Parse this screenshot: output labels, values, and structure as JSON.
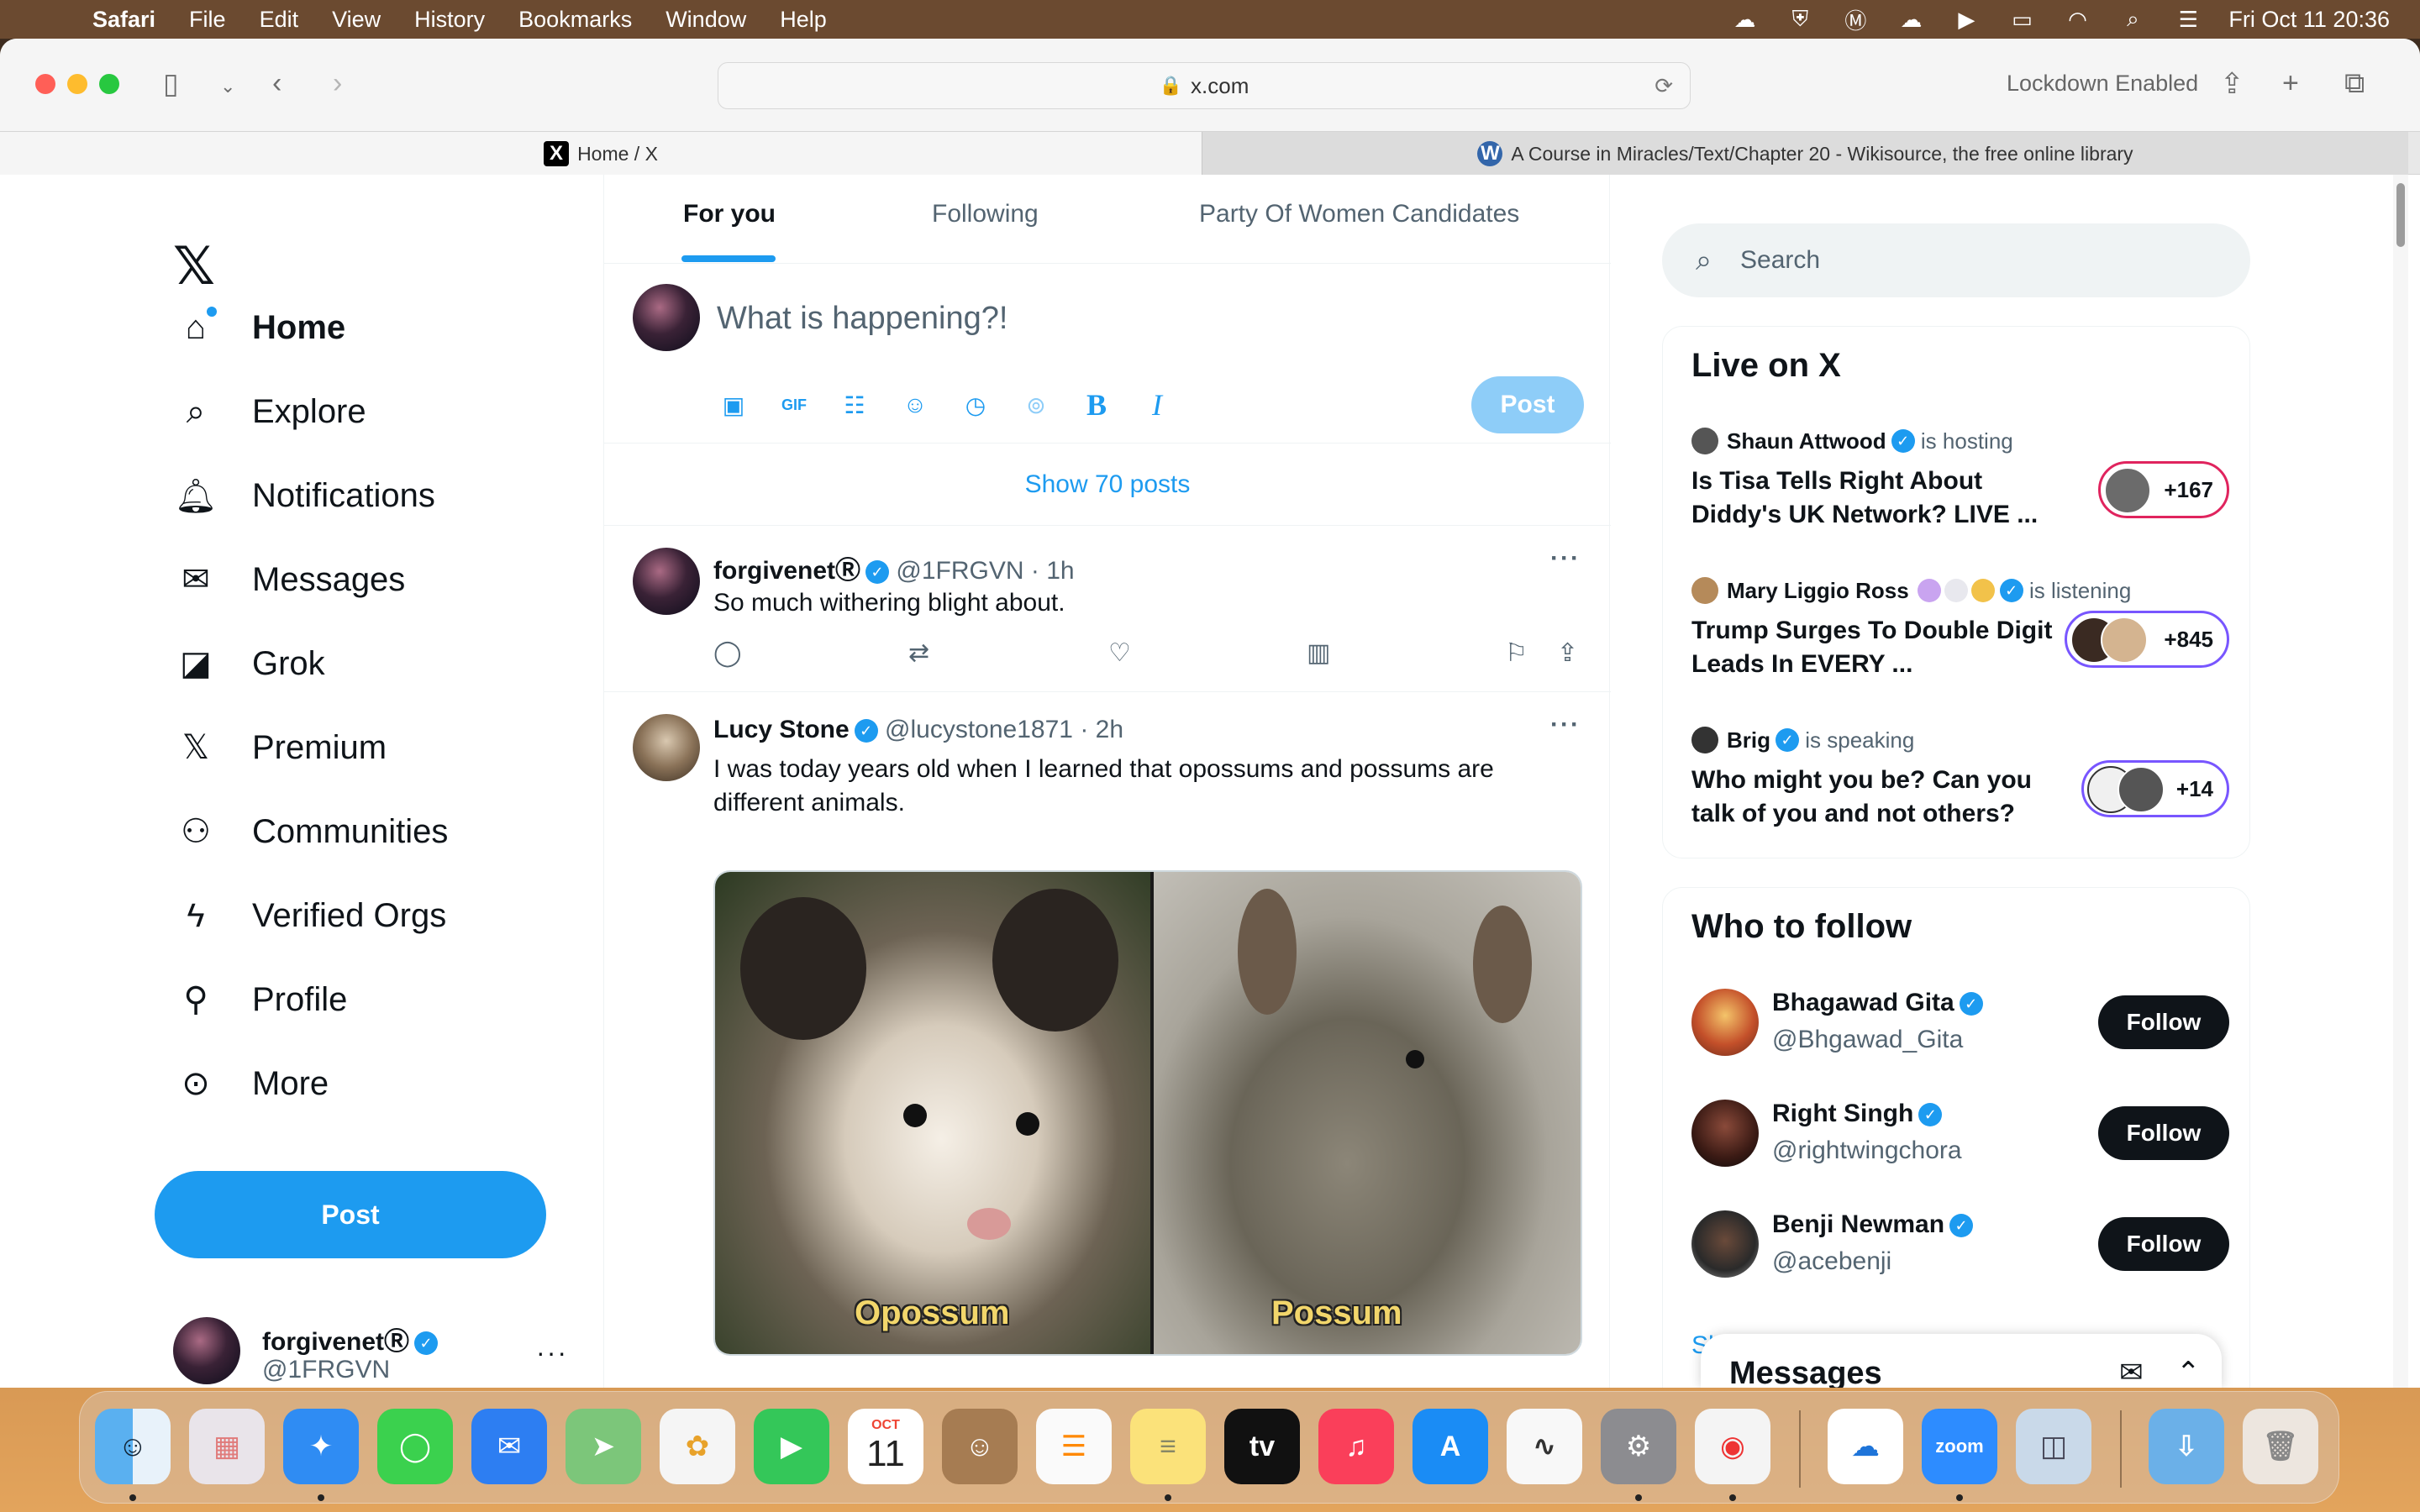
{
  "menubar": {
    "app": "Safari",
    "items": [
      "File",
      "Edit",
      "View",
      "History",
      "Bookmarks",
      "Window",
      "Help"
    ],
    "clock": "Fri Oct 11  20:36",
    "status_icons": [
      "cloud-sync-icon",
      "shield-icon",
      "malwarebytes-icon",
      "creative-cloud-icon",
      "play-icon",
      "battery-icon",
      "wifi-icon",
      "spotlight-icon",
      "control-center-icon"
    ]
  },
  "browser": {
    "url": "x.com",
    "lockdown": "Lockdown Enabled",
    "tabs": [
      {
        "title": "Home / X"
      },
      {
        "title": "A Course in Miracles/Text/Chapter 20 - Wikisource, the free online library"
      }
    ]
  },
  "nav": {
    "items": [
      {
        "label": "Home",
        "icon": "home-icon"
      },
      {
        "label": "Explore",
        "icon": "search-icon"
      },
      {
        "label": "Notifications",
        "icon": "bell-icon"
      },
      {
        "label": "Messages",
        "icon": "mail-icon"
      },
      {
        "label": "Grok",
        "icon": "grok-icon"
      },
      {
        "label": "Premium",
        "icon": "x-logo-icon"
      },
      {
        "label": "Communities",
        "icon": "people-icon"
      },
      {
        "label": "Verified Orgs",
        "icon": "lightning-icon"
      },
      {
        "label": "Profile",
        "icon": "person-icon"
      },
      {
        "label": "More",
        "icon": "more-circle-icon"
      }
    ],
    "post_label": "Post",
    "account": {
      "name": "forgivenetⓇ",
      "handle": "@1FRGVN"
    }
  },
  "feed": {
    "tabs": [
      "For you",
      "Following",
      "Party Of Women Candidates"
    ],
    "composer_placeholder": "What is happening?!",
    "composer_post": "Post",
    "show_posts": "Show 70 posts",
    "tweets": [
      {
        "name": "forgivenetⓇ",
        "handle": "@1FRGVN",
        "time": "1h",
        "text": "So much withering blight about."
      },
      {
        "name": "Lucy Stone",
        "handle": "@lucystone1871",
        "time": "2h",
        "text": "I was today years old when I learned that opossums and possums are different animals.",
        "image_captions": [
          "Opossum",
          "Possum"
        ]
      }
    ]
  },
  "sidebar": {
    "search_placeholder": "Search",
    "live": {
      "title": "Live on X",
      "items": [
        {
          "host": "Shaun Attwood",
          "status": "is hosting",
          "title": "Is Tisa Tells Right About Diddy's UK Network? LIVE ...",
          "count": "+167"
        },
        {
          "host": "Mary Liggio Ross",
          "status": "is listening",
          "title": "Trump Surges To Double Digit Leads In EVERY ...",
          "count": "+845"
        },
        {
          "host": "Brig",
          "status": "is speaking",
          "title": "Who might you be? Can you talk of you and not others?",
          "count": "+14"
        }
      ]
    },
    "who_to_follow": {
      "title": "Who to follow",
      "follow_label": "Follow",
      "items": [
        {
          "name": "Bhagawad Gita",
          "handle": "@Bhgawad_Gita"
        },
        {
          "name": "Right Singh",
          "handle": "@rightwingchora"
        },
        {
          "name": "Benji Newman",
          "handle": "@acebenji"
        }
      ],
      "show_more_partial": "Sh"
    },
    "messages_drawer": "Messages"
  },
  "dock": {
    "apps": [
      "Finder",
      "Launchpad",
      "Safari",
      "Messages",
      "Mail",
      "Maps",
      "Photos",
      "FaceTime",
      "Calendar",
      "Contacts",
      "Reminders",
      "Notes",
      "TV",
      "Music",
      "App Store",
      "Freeform",
      "System Settings",
      "Chrome",
      "OneDrive",
      "Zoom",
      "Preview",
      "Downloads",
      "Trash"
    ],
    "calendar_month": "OCT",
    "calendar_day": "11",
    "tv_label": "tv",
    "zoom_label": "zoom"
  }
}
